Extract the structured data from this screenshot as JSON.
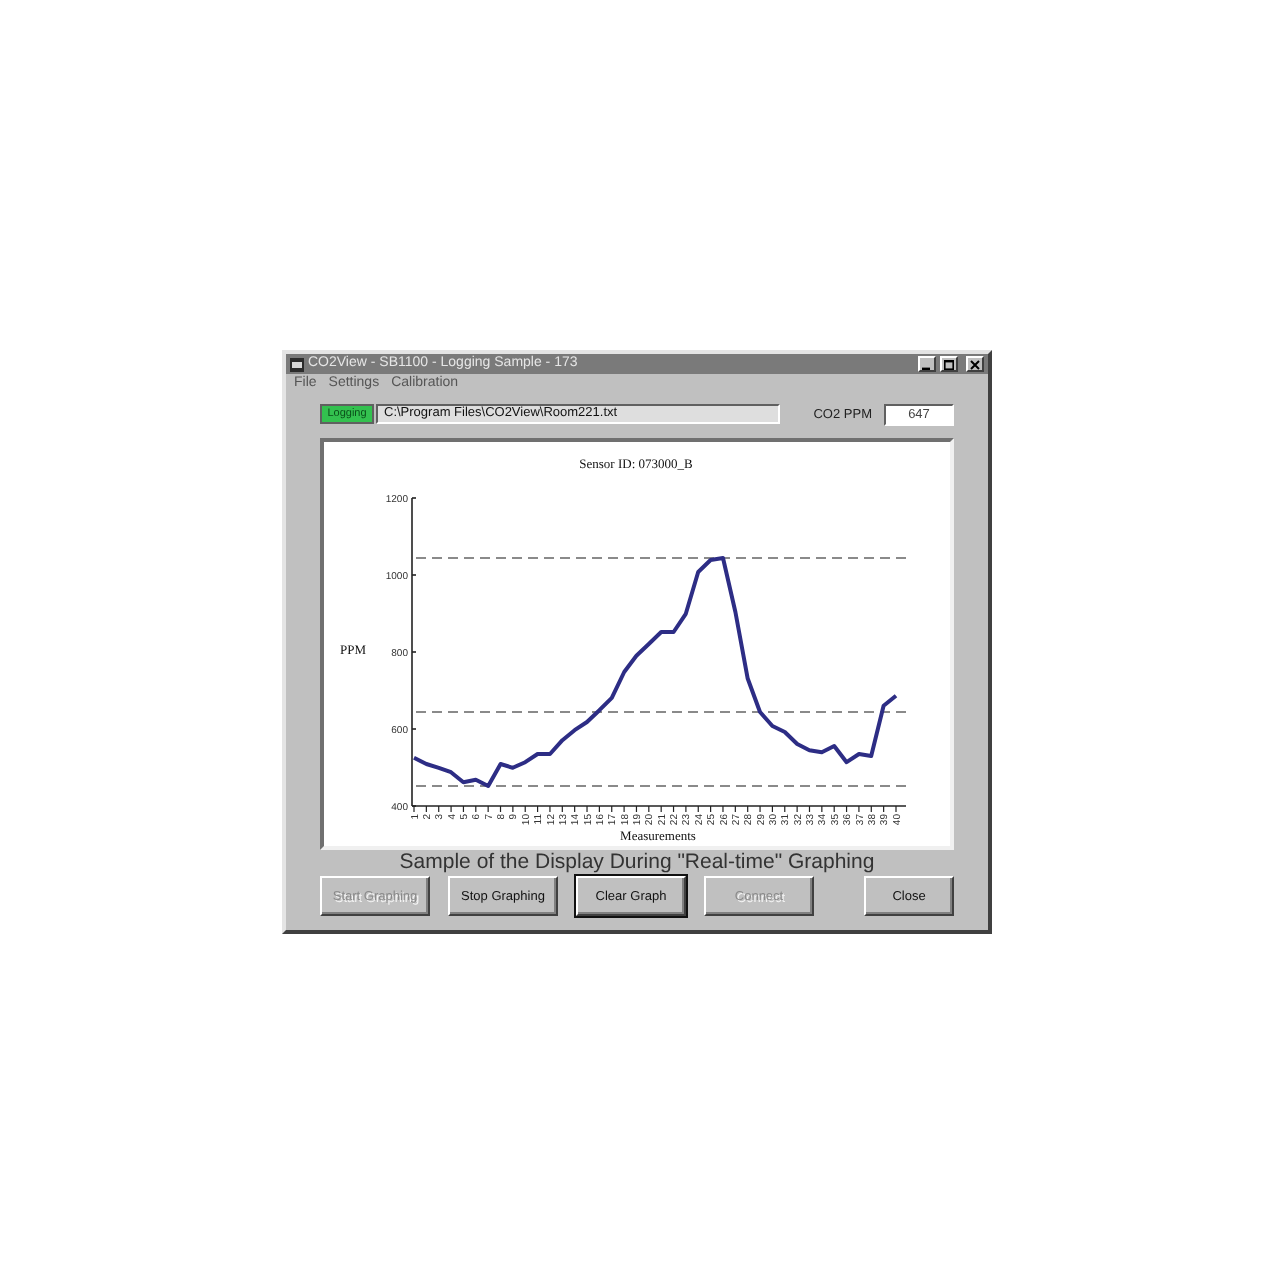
{
  "window": {
    "title": "CO2View - SB1100 - Logging Sample - 173"
  },
  "menu": [
    "File",
    "Settings",
    "Calibration"
  ],
  "status": {
    "label": "Logging",
    "on": true
  },
  "file_path": {
    "value": "C:\\Program Files\\CO2View\\Room221.txt"
  },
  "ppm": {
    "label": "CO2 PPM",
    "value": "647"
  },
  "graph": {
    "chart_data": {
      "type": "line",
      "title": "Sensor ID: 073000_B",
      "xlabel": "Measurements",
      "ylabel": "PPM",
      "x": [
        1,
        2,
        3,
        4,
        5,
        6,
        7,
        8,
        9,
        10,
        11,
        12,
        13,
        14,
        15,
        16,
        17,
        18,
        19,
        20,
        21,
        22,
        23,
        24,
        25,
        26,
        27,
        28,
        29,
        30,
        31,
        32,
        33,
        34,
        35,
        36,
        37,
        38,
        39,
        40
      ],
      "values": [
        525,
        509,
        499,
        488,
        462,
        468,
        452,
        509,
        499,
        514,
        535,
        535,
        571,
        597,
        618,
        649,
        681,
        748,
        790,
        821,
        852,
        852,
        899,
        1008,
        1039,
        1044,
        904,
        732,
        644,
        608,
        592,
        561,
        545,
        540,
        556,
        514,
        535,
        530,
        660,
        686
      ],
      "ylim": [
        400,
        1200
      ],
      "yticks": [
        400,
        600,
        800,
        1000,
        1200
      ]
    },
    "ref_lines": [
      {
        "kind": "max"
      },
      {
        "kind": "mean"
      },
      {
        "kind": "min"
      }
    ]
  },
  "caption": "Sample of the Display During \"Real-time\" Graphing",
  "buttons": [
    {
      "label": "Start Graphing",
      "disabled": true,
      "default": false
    },
    {
      "label": "Stop Graphing",
      "disabled": false,
      "default": false
    },
    {
      "label": "Clear Graph",
      "disabled": false,
      "default": true
    },
    {
      "label": "Connect",
      "disabled": true,
      "default": false
    },
    {
      "label": "Close",
      "disabled": false,
      "default": false
    }
  ]
}
